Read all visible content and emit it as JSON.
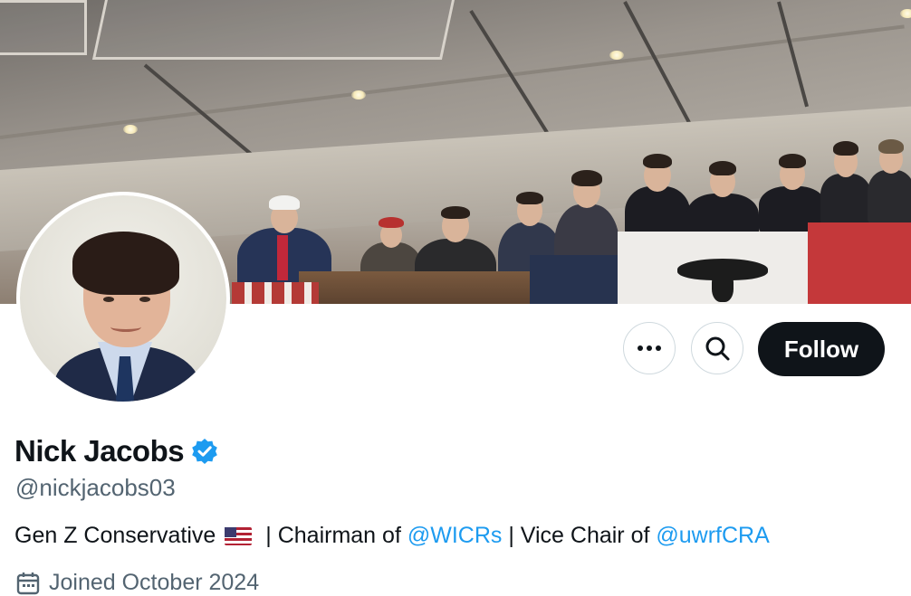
{
  "profile": {
    "display_name": "Nick Jacobs",
    "handle": "@nickjacobs03",
    "verified": true,
    "bio": {
      "part1": "Gen Z Conservative",
      "part2": " | Chairman of ",
      "mention1": "@WICRs",
      "part3": " | Vice Chair of ",
      "mention2": "@uwrfCRA"
    },
    "joined": "Joined October 2024"
  },
  "actions": {
    "more_icon": "more-horizontal-icon",
    "search_icon": "search-icon",
    "follow_label": "Follow"
  },
  "colors": {
    "accent": "#1d9bf0",
    "text_primary": "#0f1419",
    "text_secondary": "#536471",
    "follow_bg": "#0f1419",
    "verified_badge": "#1d9bf0"
  },
  "icons": {
    "verified": "verified-badge-icon",
    "flag": "us-flag-icon",
    "calendar": "calendar-icon"
  }
}
